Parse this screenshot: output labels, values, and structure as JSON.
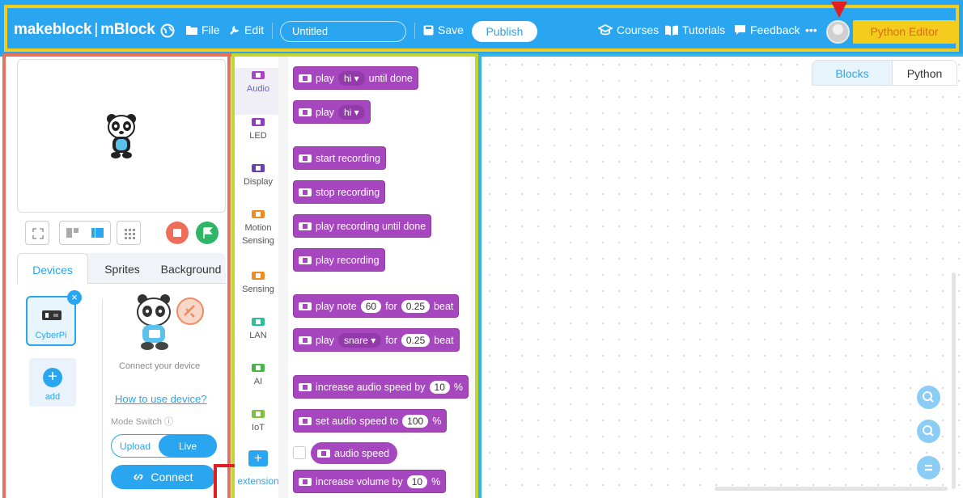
{
  "header": {
    "logo_brand": "makeblock",
    "logo_separator": "|",
    "logo_app": "mBlock",
    "file_label": "File",
    "edit_label": "Edit",
    "project_title": "Untitled",
    "save_label": "Save",
    "publish_label": "Publish",
    "courses_label": "Courses",
    "tutorials_label": "Tutorials",
    "feedback_label": "Feedback",
    "more_label": "•••",
    "python_editor_label": "Python Editor"
  },
  "left": {
    "tabs": [
      "Devices",
      "Sprites",
      "Background"
    ],
    "device_name": "CyberPi",
    "add_label": "add",
    "connect_message": "Connect your device",
    "how_to_link": "How to use device?",
    "mode_switch_label": "Mode Switch ⓘ",
    "mode_upload": "Upload",
    "mode_live": "Live",
    "connect_label": "Connect"
  },
  "categories": [
    "Audio",
    "LED",
    "Display",
    "Motion Sensing",
    "Sensing",
    "LAN",
    "AI",
    "IoT"
  ],
  "category_colors": [
    "#a747c0",
    "#8a3fc4",
    "#6a3fb0",
    "#f08a24",
    "#f08a24",
    "#2bbf9a",
    "#48b548",
    "#7cc142"
  ],
  "extension_label": "extension",
  "blocks": {
    "b1": {
      "pre": "play",
      "dd": "hi",
      "post": "until done"
    },
    "b2": {
      "pre": "play",
      "dd": "hi"
    },
    "b3": "start recording",
    "b4": "stop recording",
    "b5": "play recording until done",
    "b6": "play recording",
    "b7": {
      "pre": "play note",
      "v1": "60",
      "mid": "for",
      "v2": "0.25",
      "post": "beat"
    },
    "b8": {
      "pre": "play",
      "dd": "snare",
      "mid": "for",
      "v2": "0.25",
      "post": "beat"
    },
    "b9": {
      "pre": "increase audio speed by",
      "v1": "10",
      "post": "%"
    },
    "b10": {
      "pre": "set audio speed to",
      "v1": "100",
      "post": "%"
    },
    "b11": "audio speed",
    "b12": {
      "pre": "increase volume by",
      "v1": "10",
      "post": "%"
    }
  },
  "workspace": {
    "tab_blocks": "Blocks",
    "tab_python": "Python"
  },
  "colors": {
    "header_blue": "#2aa6f0",
    "audio_purple": "#a747c0",
    "python_editor_yellow": "#f4cc1d"
  }
}
